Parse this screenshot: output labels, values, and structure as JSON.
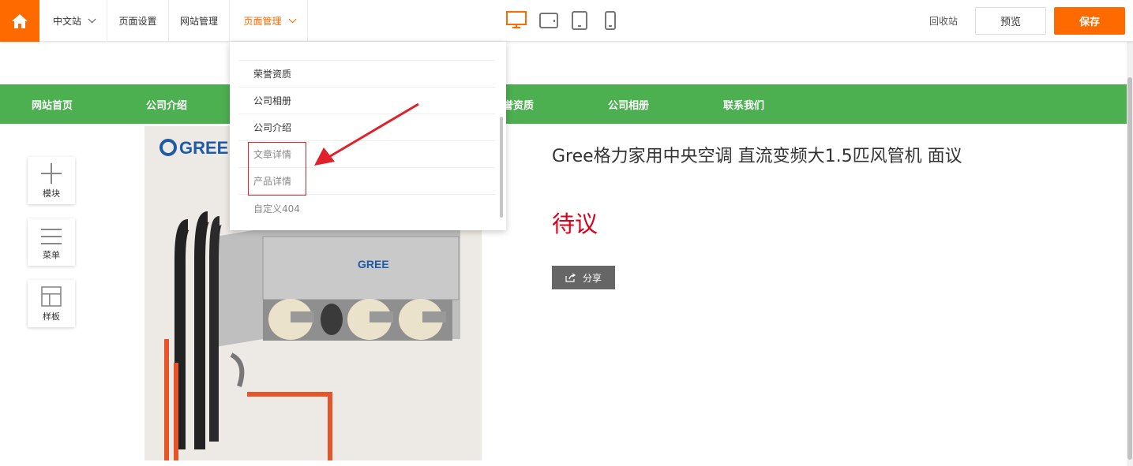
{
  "topbar": {
    "home_icon": "home-icon",
    "site_selector": "中文站",
    "page_settings": "页面设置",
    "site_management": "网站管理",
    "page_management": "页面管理",
    "devices": [
      "desktop-icon",
      "tablet-landscape-icon",
      "tablet-portrait-icon",
      "mobile-icon"
    ],
    "recycle": "回收站",
    "preview": "预览",
    "save": "保存",
    "accent_color": "#ff6a00"
  },
  "site_nav": {
    "color": "#4caf50",
    "items": [
      "网站首页",
      "公司介绍",
      "荣誉资质",
      "公司相册",
      "联系我们"
    ],
    "partial_item": "誉资质"
  },
  "tools": [
    {
      "label": "模块",
      "icon": "plus-icon"
    },
    {
      "label": "菜单",
      "icon": "menu-icon"
    },
    {
      "label": "样板",
      "icon": "template-icon"
    }
  ],
  "product": {
    "title": "Gree格力家用中央空调 直流变频大1.5匹风管机 面议",
    "price": "待议",
    "share": "分享",
    "brand_logo": "GREE",
    "price_color": "#d9001b"
  },
  "dropdown": {
    "items": [
      {
        "label": "荣誉资质"
      },
      {
        "label": "公司相册"
      },
      {
        "label": "公司介绍"
      },
      {
        "label": "文章详情"
      },
      {
        "label": "产品详情"
      },
      {
        "label": "自定义404"
      }
    ],
    "highlight_color": "#e0202a"
  }
}
